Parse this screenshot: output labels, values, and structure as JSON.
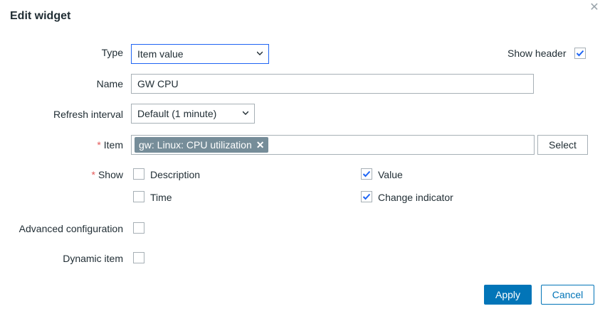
{
  "dialog": {
    "title": "Edit widget",
    "close_icon": "close-icon"
  },
  "form": {
    "type": {
      "label": "Type",
      "value": "Item value"
    },
    "show_header": {
      "label": "Show header",
      "checked": true
    },
    "name": {
      "label": "Name",
      "value": "GW CPU"
    },
    "refresh_interval": {
      "label": "Refresh interval",
      "value": "Default (1 minute)"
    },
    "item": {
      "required_mark": "*",
      "label": "Item",
      "selected": "gw: Linux: CPU utilization",
      "remove_icon": "remove-icon",
      "select_label": "Select"
    },
    "show": {
      "required_mark": "*",
      "label": "Show",
      "options": [
        {
          "label": "Description",
          "checked": false
        },
        {
          "label": "Value",
          "checked": true
        },
        {
          "label": "Time",
          "checked": false
        },
        {
          "label": "Change indicator",
          "checked": true
        }
      ]
    },
    "advanced_configuration": {
      "label": "Advanced configuration",
      "checked": false
    },
    "dynamic_item": {
      "label": "Dynamic item",
      "checked": false
    }
  },
  "footer": {
    "apply_label": "Apply",
    "cancel_label": "Cancel"
  },
  "colors": {
    "primary": "#0275b8",
    "checkmark": "#1f65f4",
    "required": "#e45959",
    "chip_bg": "#768d99"
  }
}
